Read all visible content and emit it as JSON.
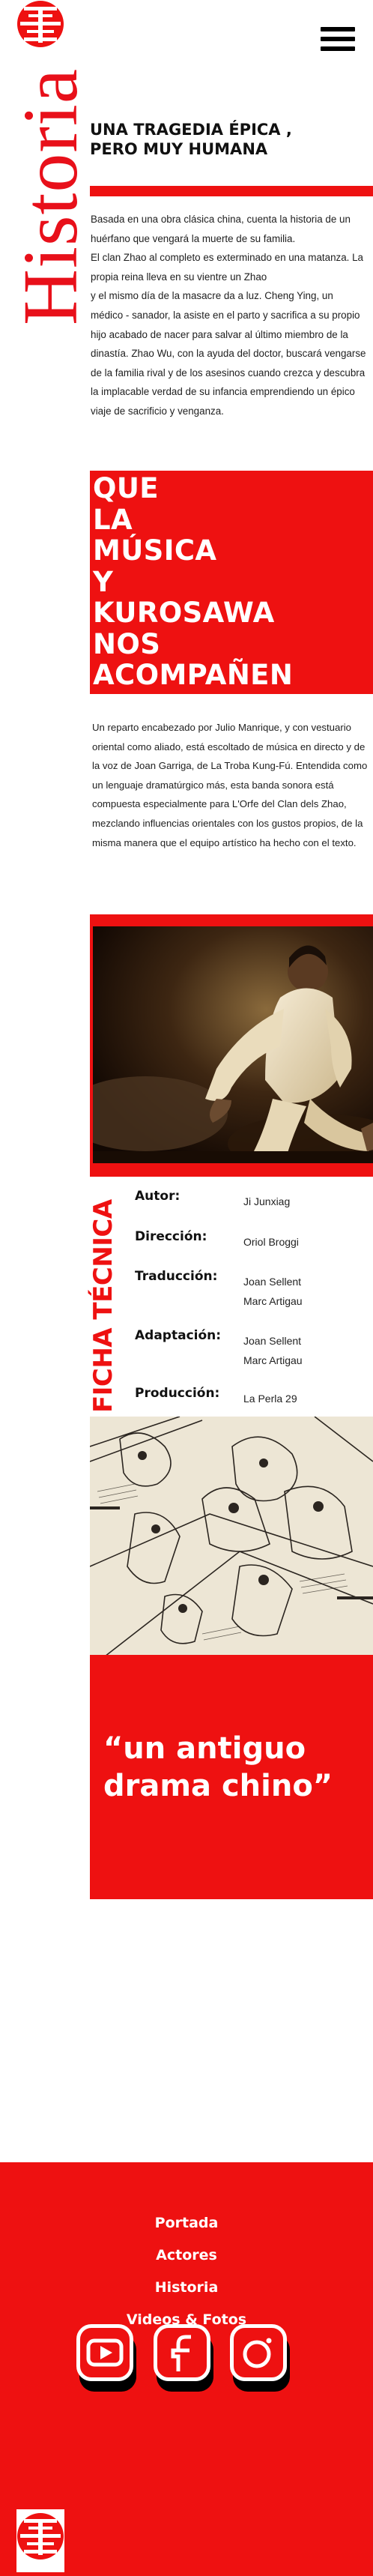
{
  "header": {
    "logo_icon": "circular-emblem-icon",
    "menu_icon": "hamburger-menu-icon",
    "section_title": "Historia"
  },
  "intro": {
    "subtitle": "UNA TRAGEDIA ÉPICA ,\nPERO MUY HUMANA",
    "paragraph": "Basada en una obra clásica china, cuenta la historia de un huérfano que vengará la muerte de su familia.\n El clan Zhao al completo es exterminado en una matanza. La propia reina lleva en su vientre un Zhao\n y el mismo día de la masacre da a luz. Cheng Ying, un médico - sanador, la asiste en el parto y sacrifica a su propio hijo acabado de nacer para salvar al último miembro de la dinastía. Zhao Wu, con la ayuda del doctor, buscará vengarse de la familia rival y de los asesinos cuando crezca y descubra la implacable verdad de su infancia emprendiendo un épico viaje de sacrificio y venganza."
  },
  "music": {
    "headline": "QUE\nLA\nMÚSICA\nY\nKUROSAWA\nNOS\nACOMPAÑEN",
    "paragraph": "Un reparto encabezado por Julio Manrique, y con vestuario oriental como aliado, está escoltado de música en directo y de la voz de Joan Garriga, de La Troba Kung-Fú. Entendida como un lenguaje dramatúrgico más, esta banda sonora está compuesta especialmente para L'Orfe del Clan dels Zhao, mezclando influencias orientales con los gustos propios, de la misma manera que el equipo artístico ha hecho con el texto."
  },
  "ficha": {
    "label": "FICHA TÉCNICA",
    "rows": [
      {
        "key": "Autor:",
        "value": "Ji Junxiag"
      },
      {
        "key": "Dirección:",
        "value": "Oriol Broggi"
      },
      {
        "key": "Traducción:",
        "value": "Joan Sellent\nMarc Artigau"
      },
      {
        "key": "Adaptación:",
        "value": "Joan Sellent\nMarc Artigau"
      },
      {
        "key": "Producción:",
        "value": "La Perla 29"
      }
    ]
  },
  "quote": {
    "text": "“un antiguo drama chino”"
  },
  "footer": {
    "nav": [
      "Portada",
      "Actores",
      "Historia",
      "Videos & Fotos"
    ],
    "social": [
      "youtube-icon",
      "facebook-icon",
      "instagram-icon"
    ],
    "colors": {
      "accent": "#ee1111",
      "text": "#ffffff"
    }
  }
}
